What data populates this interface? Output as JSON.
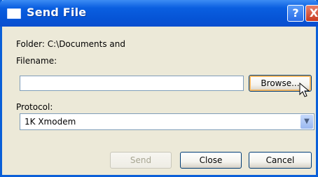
{
  "window": {
    "title": "Send File",
    "help_glyph": "?",
    "close_glyph": "X"
  },
  "dialog": {
    "folder_text": "Folder: C:\\Documents and",
    "filename_label": "Filename:",
    "filename_value": "",
    "browse_label": "Browse...",
    "protocol_label": "Protocol:",
    "protocol_selected": "1K Xmodem",
    "send_label": "Send",
    "close_label": "Close",
    "cancel_label": "Cancel"
  },
  "icons": {
    "title": "window-app-icon",
    "dropdown": "chevron-down-icon",
    "cursor": "mouse-pointer-icon"
  },
  "colors": {
    "titlebar": "#0a5fe0",
    "window_bg": "#ece9d8",
    "focus_ring": "#f5b862",
    "close_btn": "#c83a20"
  }
}
